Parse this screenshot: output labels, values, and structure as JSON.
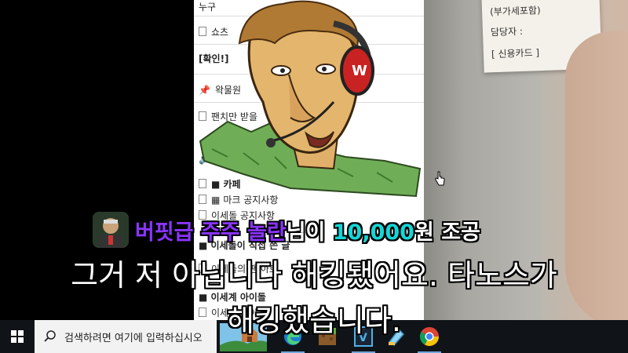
{
  "forum": {
    "items": [
      {
        "text": "누구"
      },
      {
        "text": "쇼츠"
      },
      {
        "text": "[확인!]"
      },
      {
        "text": "왁물원"
      },
      {
        "text": "팬치만 받을"
      },
      {
        "text": "■ 카페"
      },
      {
        "text": "마크 공지사항"
      },
      {
        "text": "이세돌 공지사항"
      },
      {
        "text": "■ 이세돌이 직접 쓴 글"
      },
      {
        "text": "이세돌의 팬 아트"
      },
      {
        "text": "■ 이세계 아이돌"
      },
      {
        "text": "이세계 아이돌"
      }
    ]
  },
  "receipt": {
    "lines": [
      "(부가세포함)",
      "담당자 :",
      "[ 신용카드 ]"
    ]
  },
  "donation": {
    "name": "버핏급 주주 놀란",
    "middle": "님이 ",
    "amount": "10,000",
    "suffix": "원 조공"
  },
  "subtitle": {
    "line1": "그거 저 아닙니다 해킹됐어요. 타노스가",
    "line2": "해킹했습니다."
  },
  "taskbar": {
    "search_placeholder": "검색하려면 여기에 입력하십시오",
    "apps": [
      "weather-app-icon",
      "edge-browser-icon",
      "minecraft-icon",
      "vegas-editor-icon",
      "paint-app-icon",
      "chrome-browser-icon"
    ]
  },
  "colors": {
    "donation_name": "#8a35ff",
    "donation_amount": "#14d6d6",
    "taskbar": "#101418"
  }
}
